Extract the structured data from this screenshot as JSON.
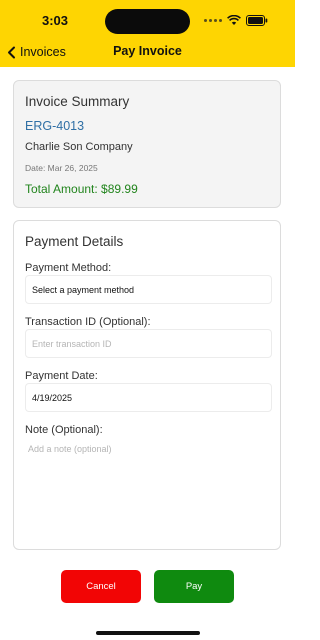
{
  "status_bar": {
    "time": "3:03"
  },
  "nav": {
    "back_label": "Invoices",
    "title": "Pay Invoice"
  },
  "summary": {
    "title": "Invoice Summary",
    "invoice_number": "ERG-4013",
    "company": "Charlie Son Company",
    "date": "Date: Mar 26, 2025",
    "total": "Total Amount: $89.99"
  },
  "payment": {
    "title": "Payment Details",
    "method_label": "Payment Method:",
    "method_value": "Select a payment method",
    "transaction_label": "Transaction ID (Optional):",
    "transaction_placeholder": "Enter transaction ID",
    "date_label": "Payment Date:",
    "date_value": "4/19/2025",
    "note_label": "Note (Optional):",
    "note_placeholder": "Add a note (optional)"
  },
  "actions": {
    "cancel_label": "Cancel",
    "pay_label": "Pay"
  },
  "colors": {
    "header": "#fed502",
    "link": "#2f6fa5",
    "total": "#21841c",
    "cancel": "#f20505",
    "pay": "#0f8a0f"
  }
}
